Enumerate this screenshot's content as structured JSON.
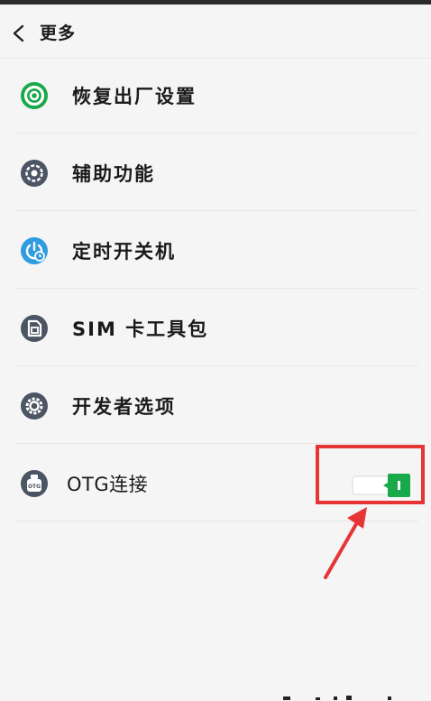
{
  "header": {
    "title": "更多"
  },
  "items": [
    {
      "label": "恢复出厂设置",
      "icon": "factory-reset-icon"
    },
    {
      "label": "辅助功能",
      "icon": "accessibility-icon"
    },
    {
      "label": "定时开关机",
      "icon": "timer-power-icon"
    },
    {
      "label": "SIM 卡工具包",
      "icon": "sim-card-icon"
    },
    {
      "label": "开发者选项",
      "icon": "developer-gear-icon"
    },
    {
      "label": "OTG连接",
      "icon": "otg-icon",
      "icon_text": "OTG",
      "toggle": "on"
    }
  ],
  "colors": {
    "green": "#18a94a",
    "accent_red": "#e53535",
    "icon_dark": "#4b5563",
    "icon_blue": "#2f9be0"
  }
}
